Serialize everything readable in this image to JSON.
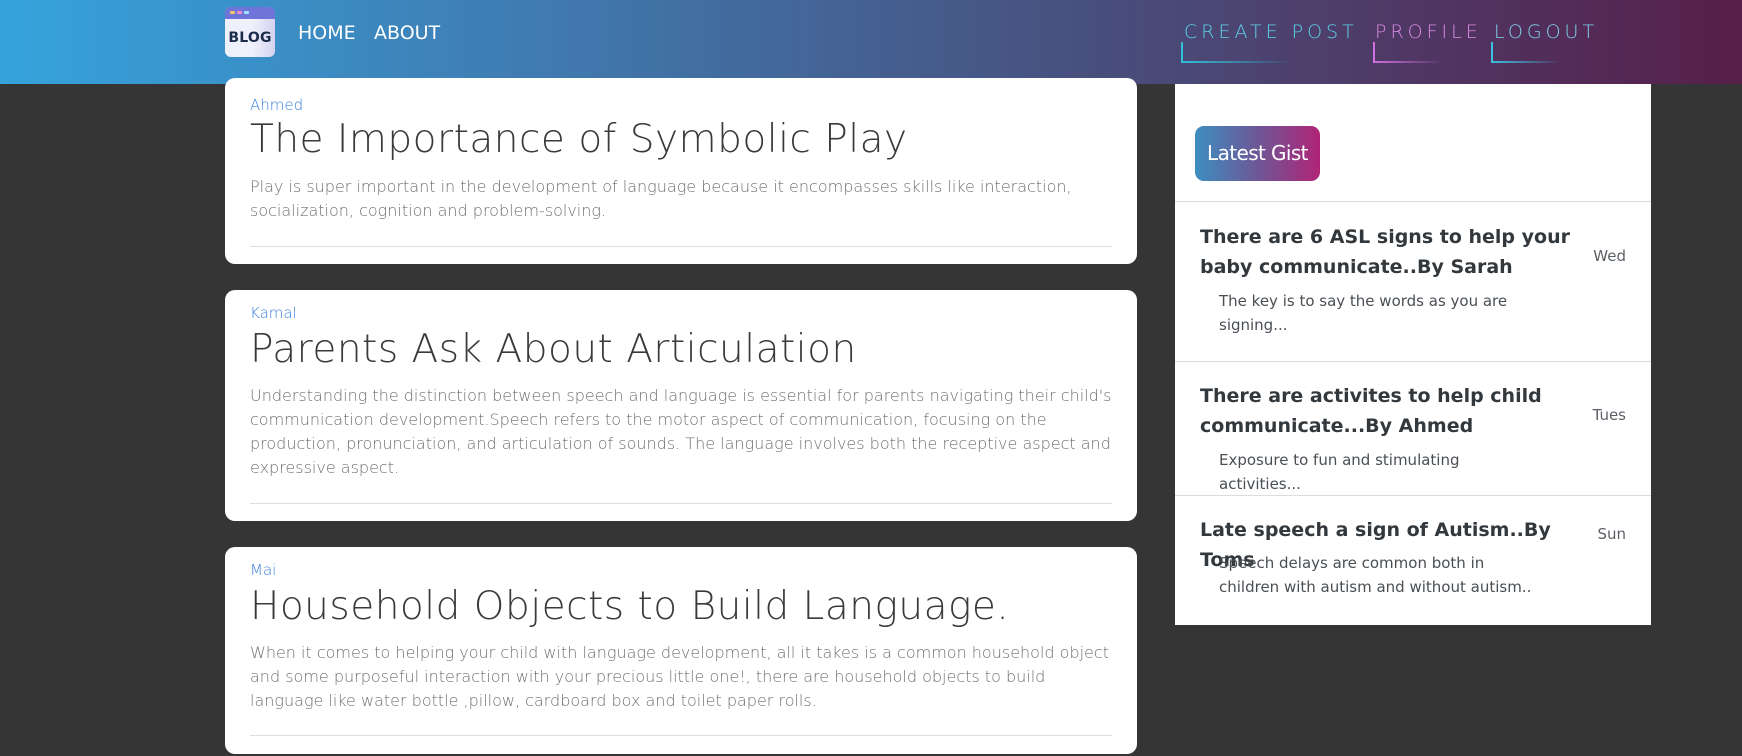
{
  "navbar": {
    "logo_text": "BLOG",
    "left_links": [
      "HOME",
      "ABOUT"
    ],
    "right_links": [
      "CREATE POST",
      "PROFILE",
      "LOGOUT"
    ],
    "colors": {
      "gradient_start": "#36a3dc",
      "gradient_end": "#571f4a",
      "create_post": "#5ed2e8",
      "profile": "#d98ae3",
      "logout": "#7fd3ea"
    }
  },
  "posts": [
    {
      "author": "Ahmed",
      "title": "The Importance of Symbolic Play",
      "body": "Play is super important in the development of language because it encompasses skills like interaction, socialization, cognition and problem-solving."
    },
    {
      "author": "Kamal",
      "title": "Parents Ask About Articulation",
      "body": "Understanding the distinction between speech and language is essential for parents navigating their child's communication development.Speech refers to the motor aspect of communication, focusing on the production, pronunciation, and articulation of sounds. The language involves both the receptive aspect and expressive aspect."
    },
    {
      "author": "Mai",
      "title": "Household Objects to Build Language.",
      "body": "When it comes to helping your child with language development, all it takes is a common household object and some purposeful interaction with your precious little one!, there are household objects to build language like water bottle ,pillow, cardboard box and toilet paper rolls."
    }
  ],
  "sidebar": {
    "badge": "Latest Gist",
    "badge_gradient": [
      "#3d8ec0",
      "#b02477"
    ],
    "items": [
      {
        "title": "There are 6 ASL signs to help your baby communicate..By Sarah",
        "excerpt": "The key is to say the words as you are signing...",
        "day": "Wed"
      },
      {
        "title": "There are activites to help child communicate...By Ahmed",
        "excerpt": "Exposure to fun and stimulating activities...",
        "day": "Tues"
      },
      {
        "title": "Late speech a sign of Autism..By Toms",
        "excerpt": "Speech delays are common both in children with autism and without autism..",
        "day": "Sun"
      }
    ]
  },
  "colors": {
    "page_background": "#353535",
    "author": "#3b7fe0"
  }
}
